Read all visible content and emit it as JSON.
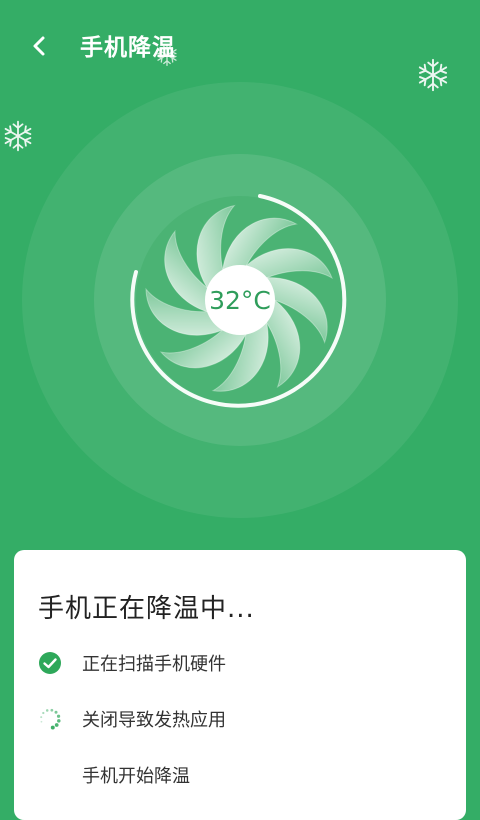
{
  "header": {
    "title": "手机降温",
    "back_icon": "back-arrow-icon"
  },
  "fan": {
    "temperature": "32°C",
    "icon": "fan-icon"
  },
  "decor": {
    "icon": "snowflake-icon"
  },
  "card": {
    "title": "手机正在降温中...",
    "steps": [
      {
        "label": "正在扫描手机硬件",
        "status": "done",
        "icon": "check-circle-icon"
      },
      {
        "label": "关闭导致发热应用",
        "status": "loading",
        "icon": "loading-spinner-icon"
      },
      {
        "label": "手机开始降温",
        "status": "pending"
      }
    ]
  },
  "colors": {
    "background": "#34ad66",
    "accent": "#2ea85a",
    "card": "#ffffff"
  }
}
